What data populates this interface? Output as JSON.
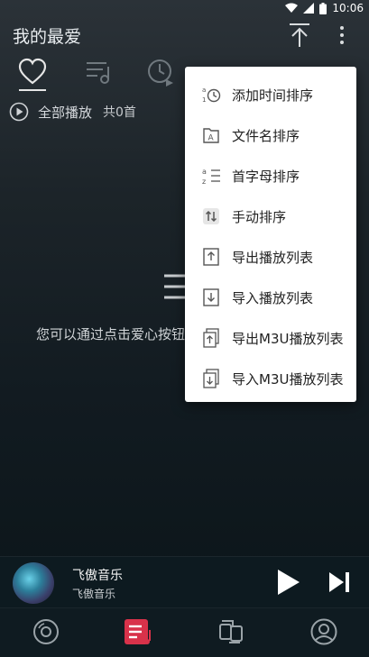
{
  "status_bar": {
    "time": "10:06"
  },
  "header": {
    "title": "我的最爱"
  },
  "tabs": [
    {
      "icon": "heart-icon",
      "active": true
    },
    {
      "icon": "music-list-icon"
    },
    {
      "icon": "history-clock-icon"
    },
    {
      "icon": "album-icon"
    },
    {
      "icon": "folder-icon"
    }
  ],
  "play_all": {
    "label": "全部播放",
    "count": "共0首"
  },
  "empty_state": {
    "message": "您可以通过点击爱心按钮添加歌曲到我的最爱列表"
  },
  "menu": {
    "items": [
      {
        "label": "添加时间排序",
        "icon": "sort-time-icon"
      },
      {
        "label": "文件名排序",
        "icon": "sort-filename-icon"
      },
      {
        "label": "首字母排序",
        "icon": "sort-az-icon"
      },
      {
        "label": "手动排序",
        "icon": "sort-manual-icon"
      },
      {
        "label": "导出播放列表",
        "icon": "export-playlist-icon"
      },
      {
        "label": "导入播放列表",
        "icon": "import-playlist-icon"
      },
      {
        "label": "导出M3U播放列表",
        "icon": "export-m3u-icon"
      },
      {
        "label": "导入M3U播放列表",
        "icon": "import-m3u-icon"
      }
    ]
  },
  "player": {
    "song": "飞傲音乐",
    "artist": "飞傲音乐"
  },
  "bottom_nav": [
    {
      "icon": "disc-icon",
      "active": false
    },
    {
      "icon": "playlist-icon",
      "active": true
    },
    {
      "icon": "convert-icon",
      "active": false
    },
    {
      "icon": "profile-icon",
      "active": false
    }
  ],
  "colors": {
    "accent": "#d8324a",
    "menu_bg": "#ffffff",
    "menu_text": "#222222"
  }
}
